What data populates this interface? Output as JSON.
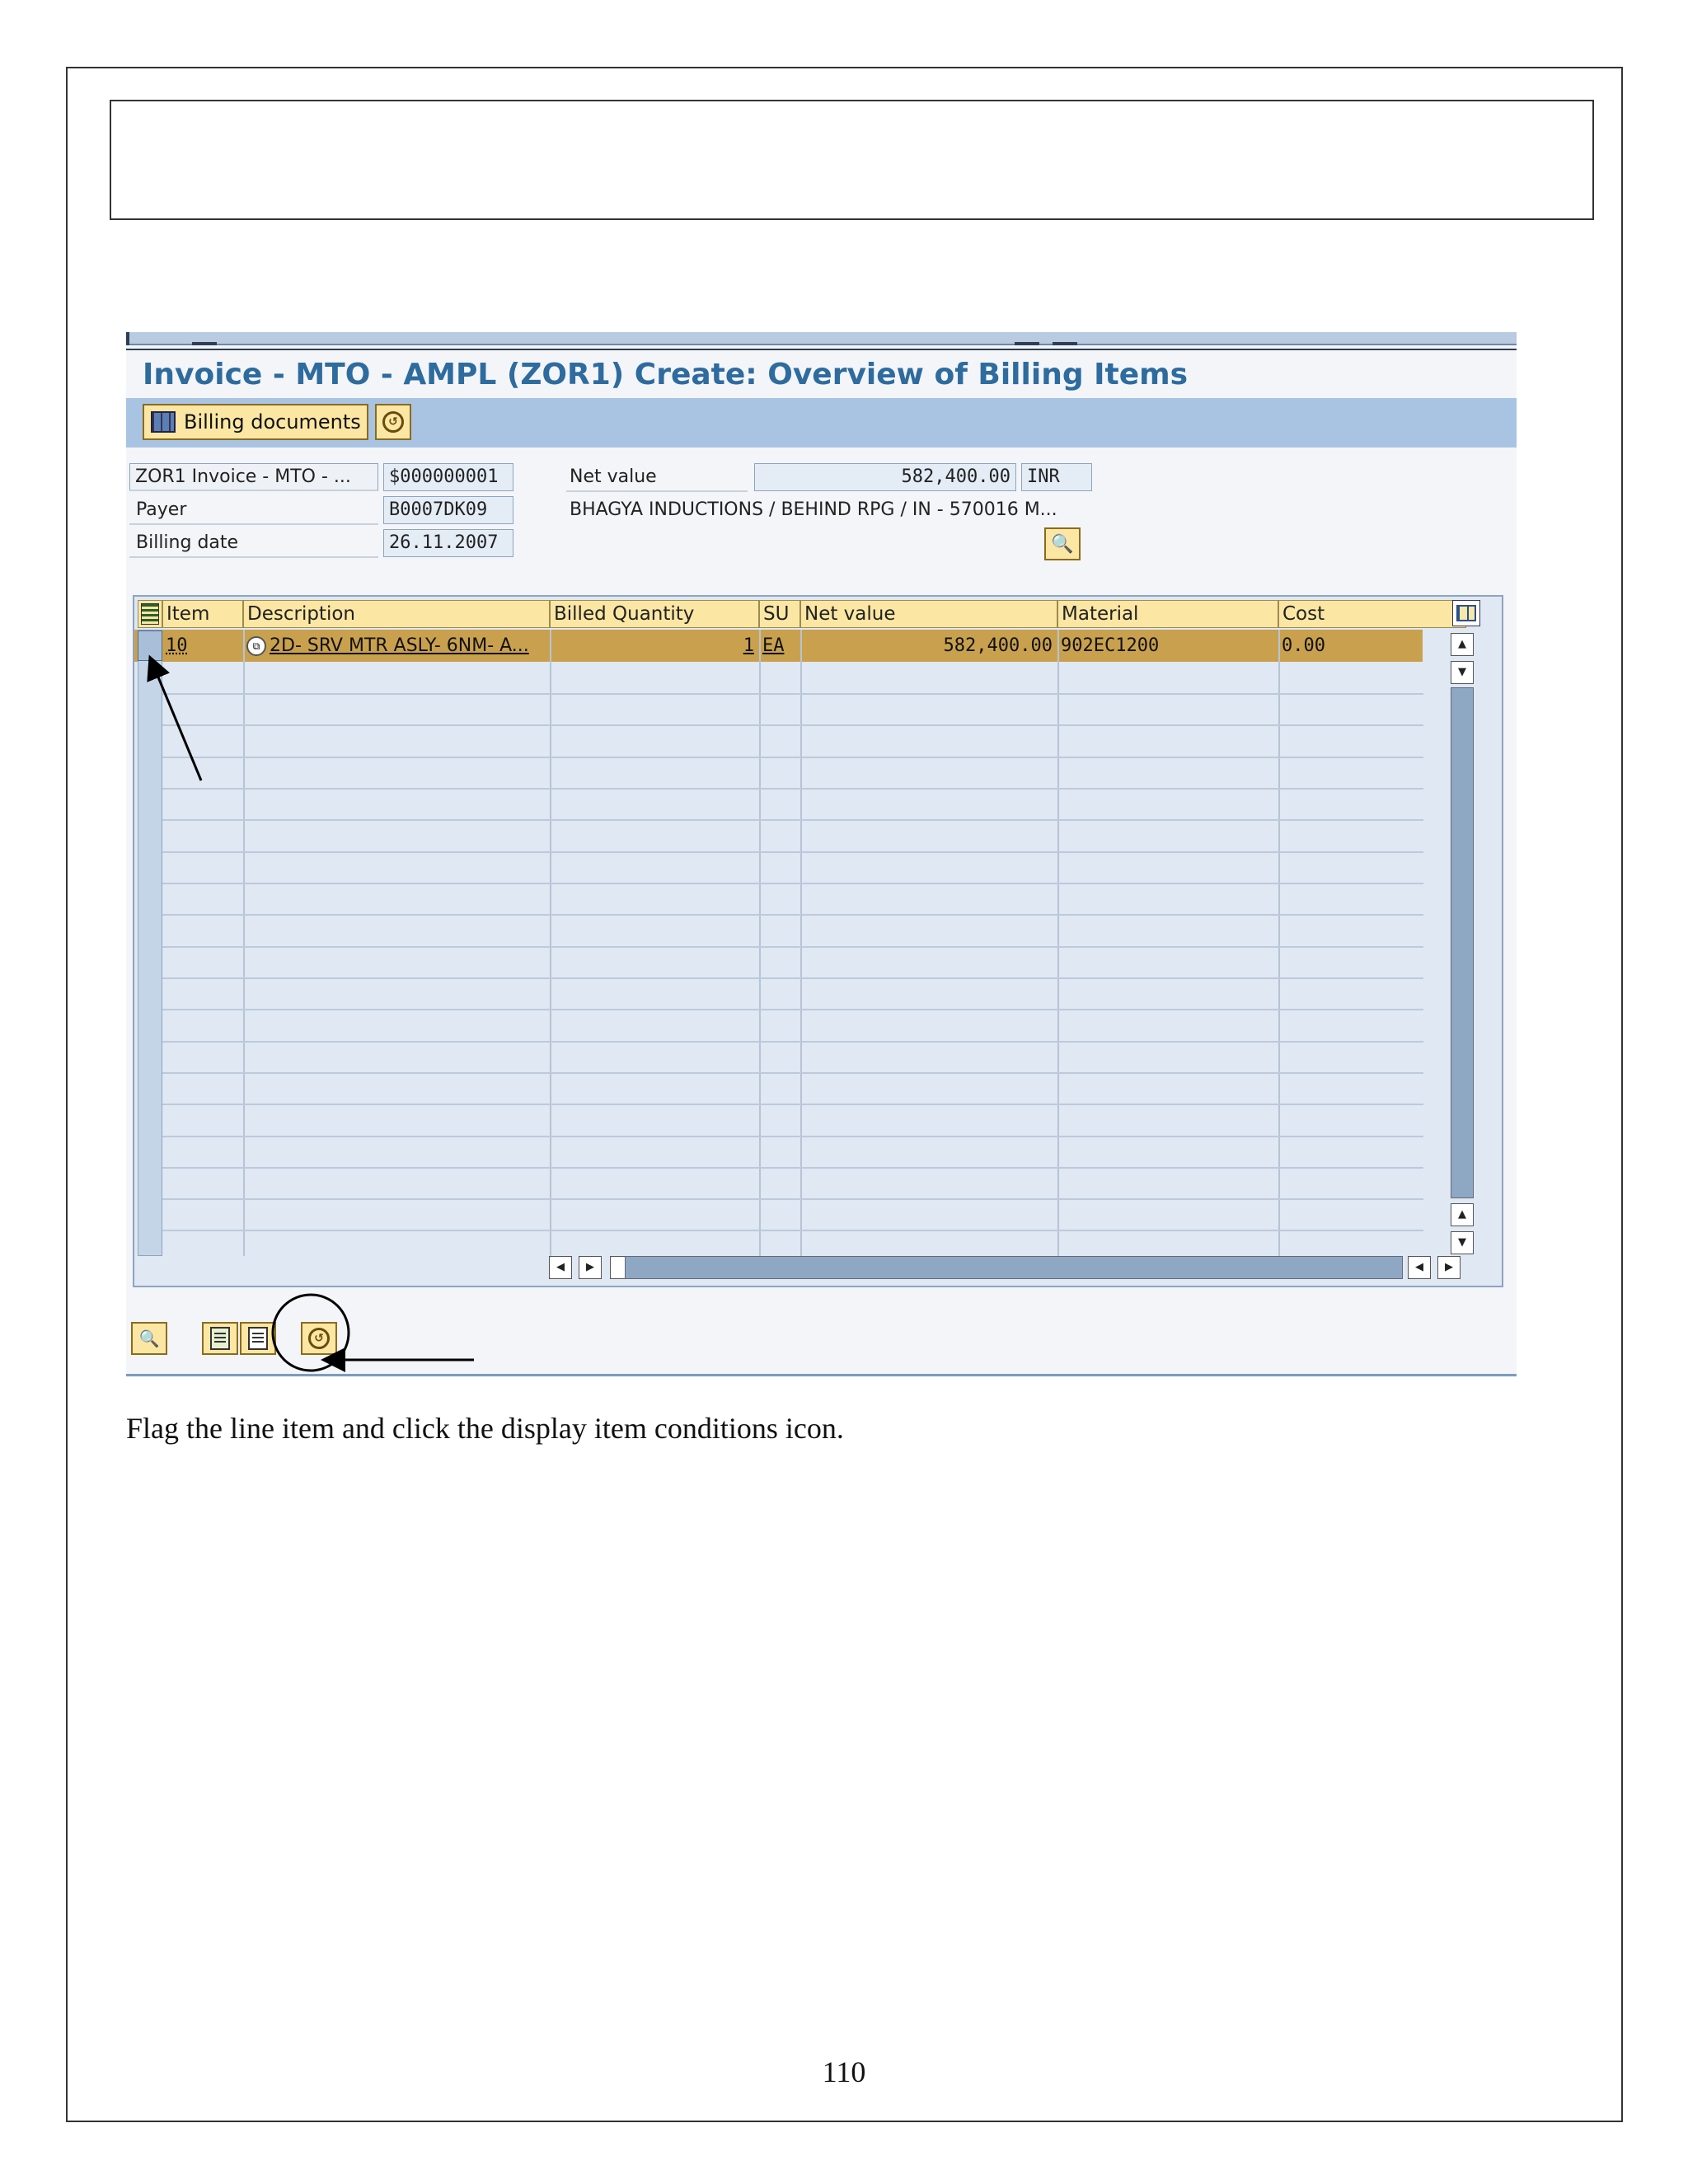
{
  "page": {
    "page_number": "110"
  },
  "caption": "Flag the line item and click the display item conditions icon.",
  "sap": {
    "title": "Invoice - MTO - AMPL  (ZOR1) Create: Overview of Billing Items",
    "toolbar": {
      "billing_documents_label": "Billing documents",
      "conditions_icon": "conditions-icon"
    },
    "header": {
      "doc_type": "ZOR1 Invoice - MTO - ...",
      "doc_number": "$000000001",
      "net_value_label": "Net value",
      "net_value": "582,400.00",
      "currency": "INR",
      "payer_label": "Payer",
      "payer": "B0007DK09",
      "payer_name": "BHAGYA INDUCTIONS / BEHIND RPG / IN - 570016 M...",
      "billing_date_label": "Billing date",
      "billing_date": "26.11.2007"
    },
    "table": {
      "columns": [
        "Item",
        "Description",
        "Billed Quantity",
        "SU",
        "Net value",
        "Material",
        "Cost"
      ],
      "rows": [
        {
          "item": "10",
          "description": "2D- SRV MTR ASLY- 6NM- A...",
          "billed_quantity": "1",
          "su": "EA",
          "net_value": "582,400.00",
          "material": "902EC1200",
          "cost": "0.00"
        }
      ]
    }
  }
}
